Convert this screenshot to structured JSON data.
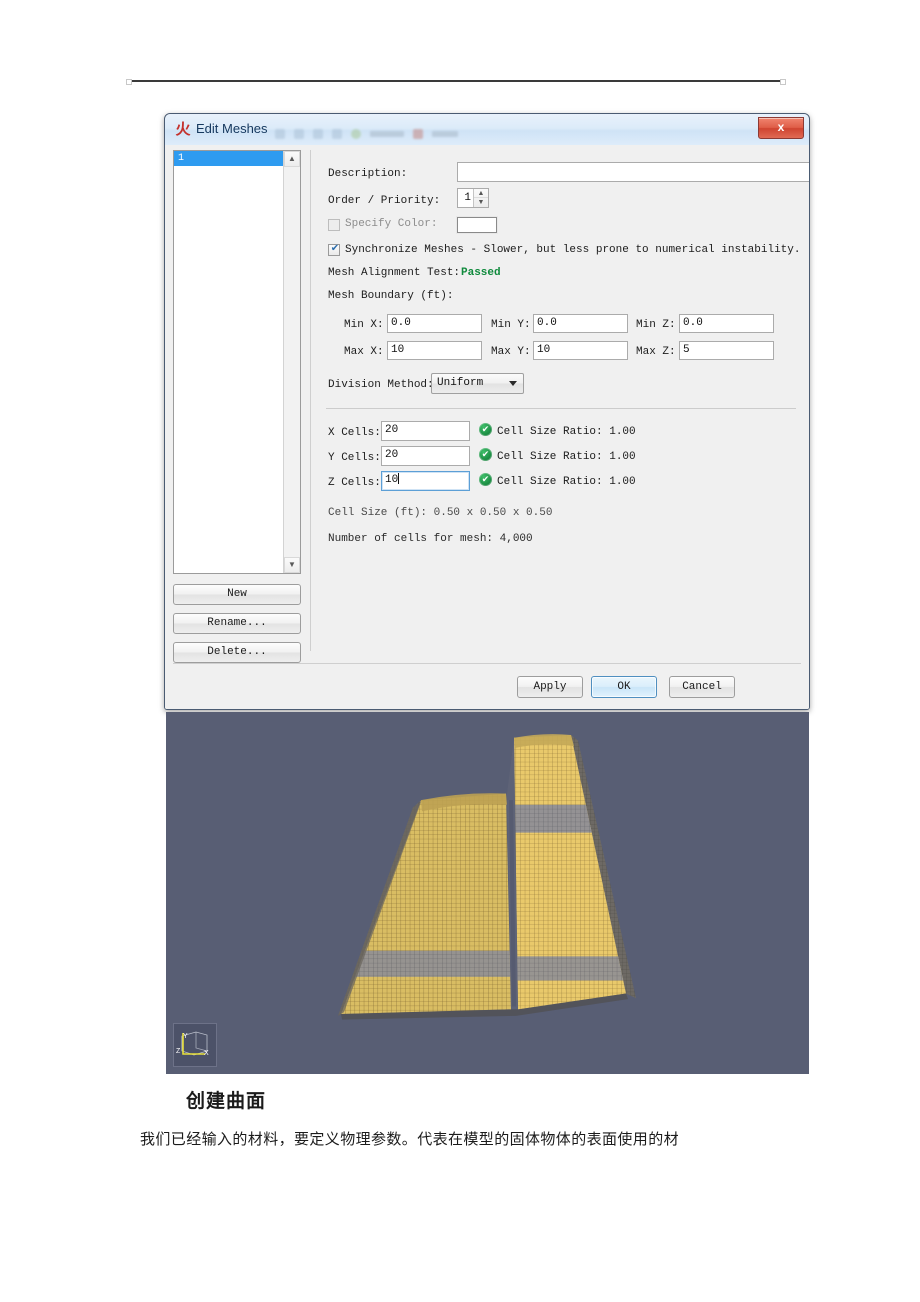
{
  "document": {
    "heading_cn": "创建曲面",
    "body_cn": "我们已经输入的材料，要定义物理参数。代表在模型的固体物体的表面使用的材"
  },
  "dialog": {
    "title": "Edit Meshes",
    "title_icon": "pyrosim-flame-icon",
    "close_label": "x",
    "list": {
      "items": [
        {
          "label": "1",
          "selected": true
        }
      ],
      "scroll_up": "▲",
      "scroll_down": "▼"
    },
    "side_buttons": {
      "new": "New",
      "rename": "Rename...",
      "delete": "Delete..."
    },
    "form": {
      "description_label": "Description:",
      "description_value": "",
      "description_placeholder": "",
      "order_label": "Order / Priority:",
      "order_value": "1",
      "specify_color_label": "Specify Color:",
      "specify_color_checked": false,
      "color_swatch_hex": "#ffffff",
      "sync_meshes_label": "Synchronize Meshes - Slower, but less prone to numerical instability.",
      "sync_meshes_checked": true,
      "alignment_label": "Mesh Alignment Test:",
      "alignment_value": "Passed",
      "alignment_color": "#0f8a3c",
      "boundary_label": "Mesh Boundary (ft):",
      "min_x_label": "Min X:",
      "min_x_value": "0.0",
      "min_y_label": "Min Y:",
      "min_y_value": "0.0",
      "min_z_label": "Min Z:",
      "min_z_value": "0.0",
      "max_x_label": "Max X:",
      "max_x_value": "10",
      "max_y_label": "Max Y:",
      "max_y_value": "10",
      "max_z_label": "Max Z:",
      "max_z_value": "5",
      "division_label": "Division Method:",
      "division_value": "Uniform",
      "division_options": [
        "Uniform"
      ],
      "x_cells_label": "X Cells:",
      "x_cells_value": "20",
      "y_cells_label": "Y Cells:",
      "y_cells_value": "20",
      "z_cells_label": "Z Cells:",
      "z_cells_value": "10",
      "ratio_x": "Cell Size Ratio: 1.00",
      "ratio_y": "Cell Size Ratio: 1.00",
      "ratio_z": "Cell Size Ratio: 1.00",
      "cell_size_text": "Cell Size (ft): 0.50 x 0.50 x 0.50",
      "cell_count_text": "Number of cells for mesh: 4,000"
    },
    "footer": {
      "apply": "Apply",
      "ok": "OK",
      "cancel": "Cancel"
    }
  },
  "viewport": {
    "background_hex": "#585e74",
    "mesh_color_hex": "#e8c86a",
    "axis_labels": {
      "x": "X",
      "y": "Y",
      "z": "Z"
    }
  }
}
